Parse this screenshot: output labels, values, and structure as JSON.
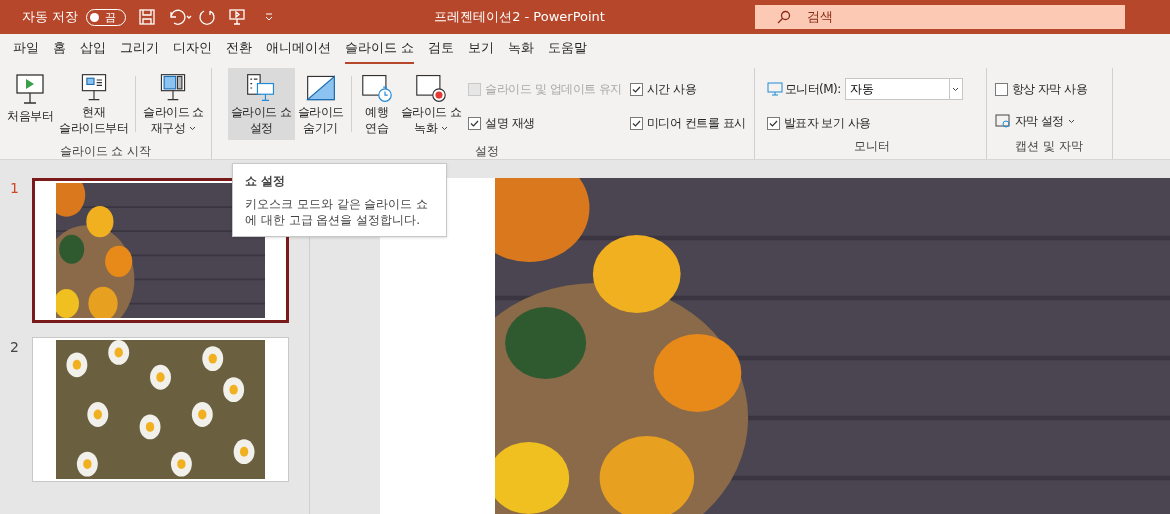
{
  "title_bar": {
    "autosave_label": "자동 저장",
    "autosave_toggle": {
      "label": "끔",
      "on": false
    },
    "title": "프레젠테이션2  -  PowerPoint",
    "search": {
      "placeholder": "검색"
    }
  },
  "tabs": [
    {
      "label": "파일",
      "selected": false
    },
    {
      "label": "홈",
      "selected": false
    },
    {
      "label": "삽입",
      "selected": false
    },
    {
      "label": "그리기",
      "selected": false
    },
    {
      "label": "디자인",
      "selected": false
    },
    {
      "label": "전환",
      "selected": false
    },
    {
      "label": "애니메이션",
      "selected": false
    },
    {
      "label": "슬라이드 쇼",
      "selected": true
    },
    {
      "label": "검토",
      "selected": false
    },
    {
      "label": "보기",
      "selected": false
    },
    {
      "label": "녹화",
      "selected": false
    },
    {
      "label": "도움말",
      "selected": false
    }
  ],
  "ribbon": {
    "groups": [
      {
        "label": "슬라이드 쇼 시작",
        "buttons": [
          {
            "kind": "play",
            "lines": [
              "처음부터"
            ],
            "dropdown": false,
            "selected": false
          },
          {
            "kind": "current",
            "lines": [
              "현재",
              "슬라이드부터"
            ],
            "dropdown": false,
            "selected": false
          },
          {
            "kind": "custom",
            "lines": [
              "슬라이드 쇼",
              "재구성"
            ],
            "dropdown": true,
            "selected": false
          }
        ]
      },
      {
        "label": "설정",
        "buttons": [
          {
            "kind": "setup",
            "lines": [
              "슬라이드 쇼",
              "설정"
            ],
            "dropdown": false,
            "selected": true
          },
          {
            "kind": "hide",
            "lines": [
              "슬라이드",
              "숨기기"
            ],
            "dropdown": false,
            "selected": false
          },
          {
            "kind": "rehearse",
            "lines": [
              "예행",
              "연습"
            ],
            "dropdown": false,
            "selected": false
          },
          {
            "kind": "record",
            "lines": [
              "슬라이드 쇼",
              "녹화"
            ],
            "dropdown": true,
            "selected": false
          }
        ],
        "checkboxes": [
          {
            "label": "슬라이드 및 업데이트 유지",
            "checked": false,
            "disabled": true
          },
          {
            "label": "시간 사용",
            "checked": true,
            "disabled": false
          },
          {
            "label": "설명 재생",
            "checked": true,
            "disabled": false
          },
          {
            "label": "미디어 컨트롤 표시",
            "checked": true,
            "disabled": false
          }
        ]
      },
      {
        "label": "모니터",
        "monitor_label": "모니터(M):",
        "monitor_value": "자동",
        "checkboxes": [
          {
            "label": "발표자 보기 사용",
            "checked": true,
            "disabled": false
          }
        ]
      },
      {
        "label": "캡션 및 자막",
        "checkboxes": [
          {
            "label": "항상 자막 사용",
            "checked": false,
            "disabled": false
          }
        ],
        "subtitle_button": "자막 설정"
      }
    ]
  },
  "tooltip": {
    "title": "쇼 설정",
    "text": "키오스크 모드와 같은 슬라이드 쇼에 대한 고급 옵션을 설정합니다."
  },
  "slides": [
    {
      "number": "1",
      "selected": true,
      "kind": "pumpkins"
    },
    {
      "number": "2",
      "selected": false,
      "kind": "daisies"
    }
  ]
}
